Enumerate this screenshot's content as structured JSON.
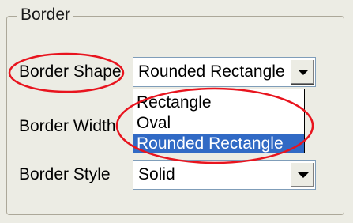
{
  "group": {
    "title": "Border"
  },
  "rows": [
    {
      "label": "Border Shape",
      "value": "Rounded Rectangle"
    },
    {
      "label": "Border Width"
    },
    {
      "label": "Border Style",
      "value": "Solid"
    }
  ],
  "dropdown": {
    "options": [
      "Rectangle",
      "Oval",
      "Rounded Rectangle"
    ],
    "selected": "Rounded Rectangle"
  },
  "colors": {
    "annotation": "#e8141e",
    "highlight": "#316ac5",
    "background": "#ecece4"
  },
  "icons": {
    "combo_arrow": "chevron-down-icon"
  }
}
